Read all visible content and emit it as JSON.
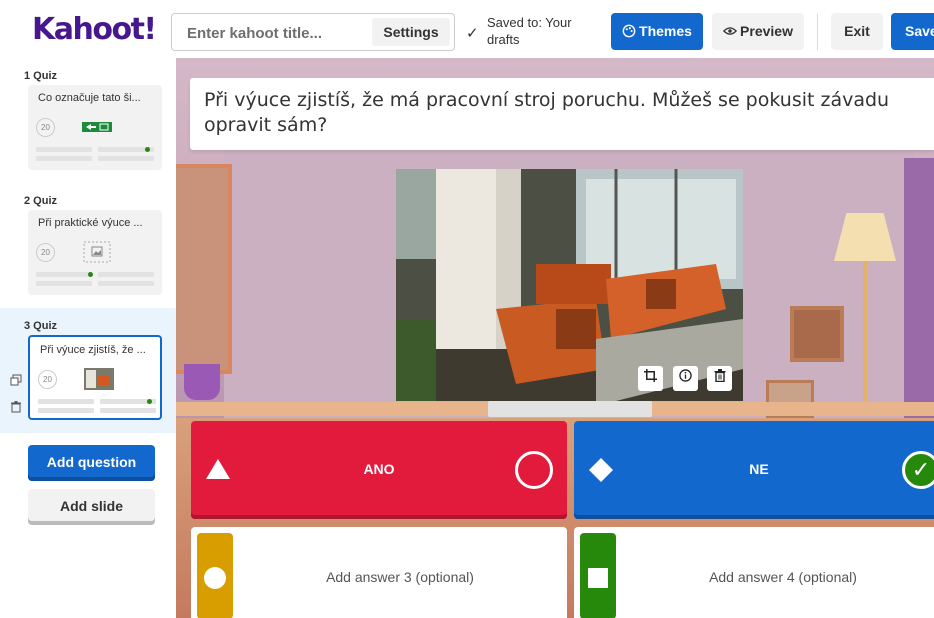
{
  "header": {
    "logo": "Kahoot!",
    "title_placeholder": "Enter kahoot title...",
    "settings_label": "Settings",
    "saved_label": "Saved to: Your drafts",
    "themes_label": "Themes",
    "preview_label": "Preview",
    "exit_label": "Exit",
    "save_label": "Save"
  },
  "sidebar": {
    "slides": [
      {
        "label": "1 Quiz",
        "question": "Co označuje tato ši...",
        "time": "20"
      },
      {
        "label": "2 Quiz",
        "question": "Při praktické výuce ...",
        "time": "20"
      },
      {
        "label": "3 Quiz",
        "question": "Při výuce zjistíš, že ...",
        "time": "20"
      }
    ],
    "add_question_label": "Add question",
    "add_slide_label": "Add slide"
  },
  "editor": {
    "question": "Při výuce zjistíš, že má pracovní stroj poruchu. Můžeš se pokusit závadu opravit sám?",
    "answers": [
      {
        "text": "ANO",
        "color": "#e21b3c",
        "shape": "triangle-icon",
        "correct": false
      },
      {
        "text": "NE",
        "color": "#1368ce",
        "shape": "diamond-icon",
        "correct": true
      },
      {
        "text": "Add answer 3 (optional)",
        "color": "#d89e00",
        "shape": "circle-icon"
      },
      {
        "text": "Add answer 4 (optional)",
        "color": "#26890c",
        "shape": "square-icon"
      }
    ]
  }
}
